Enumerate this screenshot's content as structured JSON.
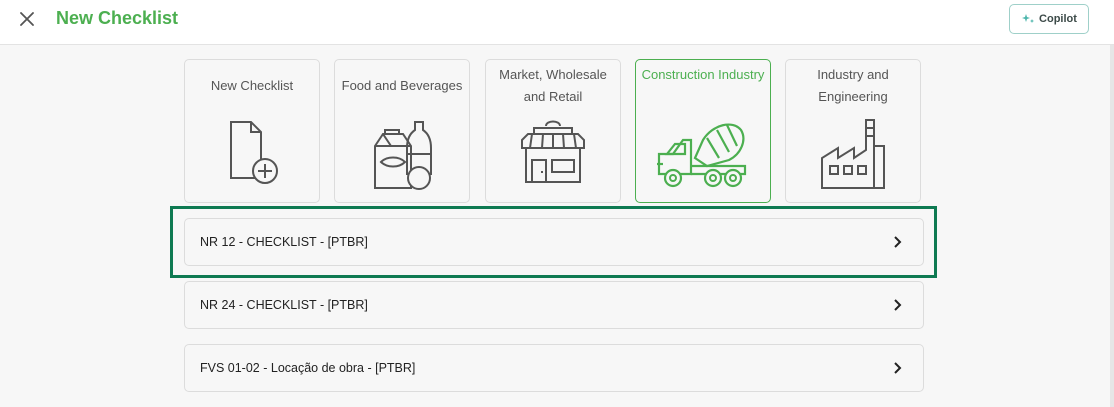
{
  "header": {
    "title": "New Checklist",
    "copilot_label": "Copilot"
  },
  "colors": {
    "accent": "#4caf50",
    "highlight": "#0e7a52",
    "copilot_border": "#9fd0c9"
  },
  "categories": [
    {
      "label": "New Checklist",
      "icon": "new-document-icon",
      "selected": false
    },
    {
      "label": "Food and Beverages",
      "icon": "food-beverages-icon",
      "selected": false
    },
    {
      "label": "Market, Wholesale and Retail",
      "icon": "storefront-icon",
      "selected": false
    },
    {
      "label": "Construction Industry",
      "icon": "cement-mixer-truck-icon",
      "selected": true
    },
    {
      "label": "Industry and Engineering",
      "icon": "factory-icon",
      "selected": false
    }
  ],
  "checklists": [
    {
      "label": "NR 12 - CHECKLIST - [PTBR]"
    },
    {
      "label": "NR 24 - CHECKLIST - [PTBR]"
    },
    {
      "label": "FVS 01-02 - Locação de obra - [PTBR]"
    }
  ]
}
